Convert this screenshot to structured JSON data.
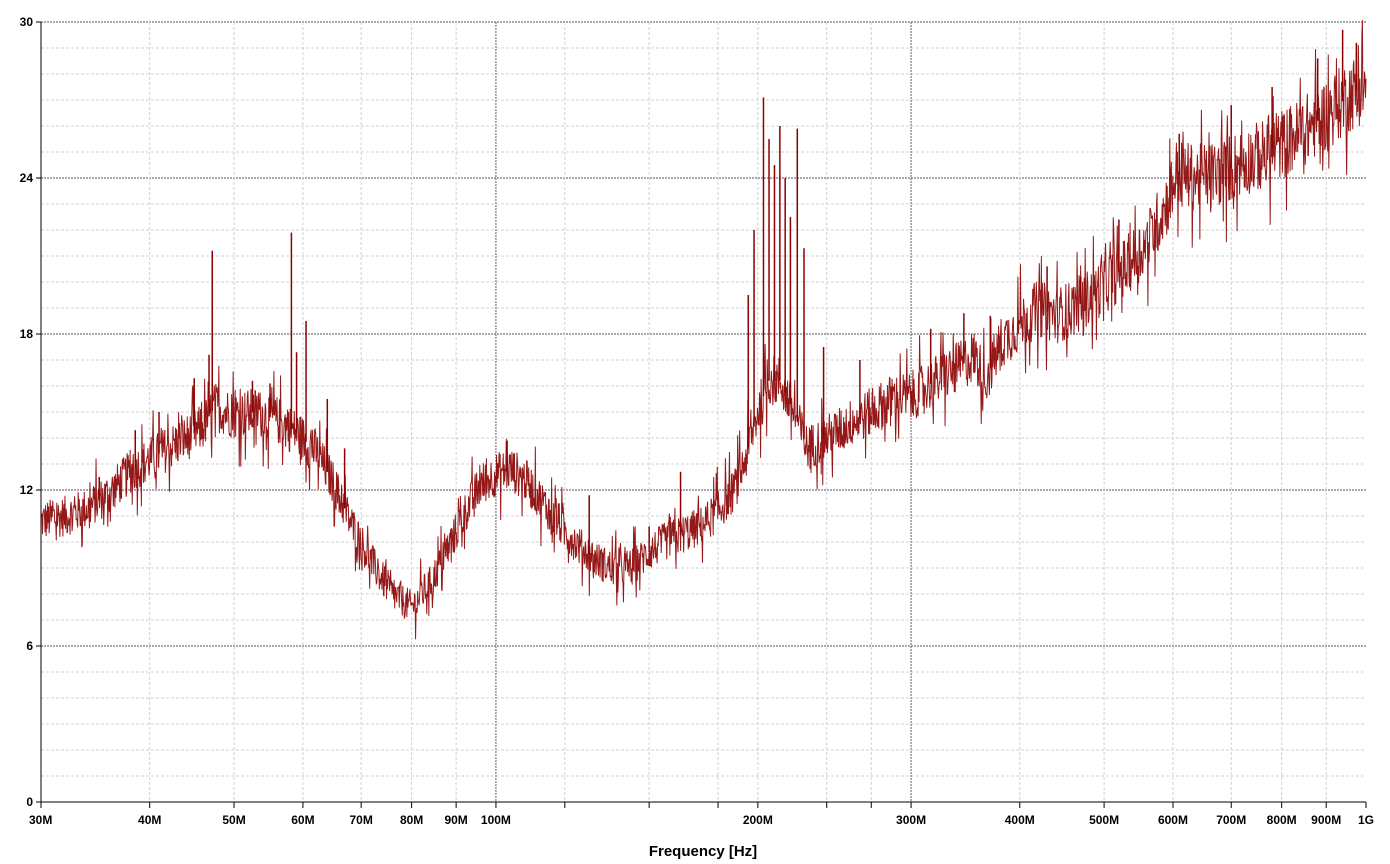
{
  "chart_data": {
    "type": "line",
    "xlabel": "Frequency [Hz]",
    "ylabel": "",
    "x_scale": "log",
    "xlim": [
      30000000,
      1000000000
    ],
    "ylim": [
      0,
      30
    ],
    "y_ticks": [
      {
        "value": 0,
        "label": "0"
      },
      {
        "value": 6,
        "label": "6"
      },
      {
        "value": 12,
        "label": "12"
      },
      {
        "value": 18,
        "label": "18"
      },
      {
        "value": 24,
        "label": "24"
      },
      {
        "value": 30,
        "label": "30"
      }
    ],
    "x_ticks": [
      {
        "value": 30000000,
        "label": "30M"
      },
      {
        "value": 40000000,
        "label": "40M"
      },
      {
        "value": 50000000,
        "label": "50M"
      },
      {
        "value": 60000000,
        "label": "60M"
      },
      {
        "value": 70000000,
        "label": "70M"
      },
      {
        "value": 80000000,
        "label": "80M"
      },
      {
        "value": 90000000,
        "label": "90M"
      },
      {
        "value": 100000000,
        "label": "100M"
      },
      {
        "value": 200000000,
        "label": "200M"
      },
      {
        "value": 300000000,
        "label": "300M"
      },
      {
        "value": 400000000,
        "label": "400M"
      },
      {
        "value": 500000000,
        "label": "500M"
      },
      {
        "value": 600000000,
        "label": "600M"
      },
      {
        "value": 700000000,
        "label": "700M"
      },
      {
        "value": 800000000,
        "label": "800M"
      },
      {
        "value": 900000000,
        "label": "900M"
      },
      {
        "value": 1000000000,
        "label": "1G"
      }
    ],
    "x_minor_gridlines": [
      120000000,
      150000000,
      180000000,
      240000000,
      270000000
    ],
    "grid": true,
    "series": [
      {
        "color": "#8b0000",
        "points": [
          [
            30000000,
            10.8
          ],
          [
            32000000,
            11.0
          ],
          [
            34000000,
            11.3
          ],
          [
            36000000,
            11.9
          ],
          [
            38000000,
            12.7
          ],
          [
            40000000,
            13.2
          ],
          [
            42000000,
            13.6
          ],
          [
            44000000,
            14.0
          ],
          [
            46000000,
            14.4
          ],
          [
            47500000,
            15.2
          ],
          [
            50000000,
            14.9
          ],
          [
            53000000,
            15.0
          ],
          [
            56000000,
            14.7
          ],
          [
            59000000,
            14.2
          ],
          [
            62000000,
            13.5
          ],
          [
            65000000,
            12.3
          ],
          [
            68000000,
            10.8
          ],
          [
            72000000,
            9.2
          ],
          [
            76000000,
            8.0
          ],
          [
            80000000,
            7.5
          ],
          [
            84000000,
            8.4
          ],
          [
            88000000,
            9.7
          ],
          [
            92000000,
            11.1
          ],
          [
            96000000,
            12.2
          ],
          [
            100000000,
            12.6
          ],
          [
            104000000,
            12.8
          ],
          [
            108000000,
            12.4
          ],
          [
            114000000,
            11.4
          ],
          [
            120000000,
            10.4
          ],
          [
            126000000,
            9.7
          ],
          [
            132000000,
            9.2
          ],
          [
            138000000,
            8.9
          ],
          [
            144000000,
            9.1
          ],
          [
            150000000,
            9.6
          ],
          [
            156000000,
            10.0
          ],
          [
            164000000,
            10.3
          ],
          [
            172000000,
            10.6
          ],
          [
            180000000,
            11.2
          ],
          [
            188000000,
            12.0
          ],
          [
            194000000,
            13.3
          ],
          [
            200000000,
            15.0
          ],
          [
            206000000,
            16.2
          ],
          [
            212000000,
            16.2
          ],
          [
            220000000,
            15.0
          ],
          [
            228000000,
            13.6
          ],
          [
            236000000,
            13.9
          ],
          [
            246000000,
            14.2
          ],
          [
            256000000,
            14.6
          ],
          [
            270000000,
            15.0
          ],
          [
            285000000,
            15.5
          ],
          [
            300000000,
            15.6
          ],
          [
            320000000,
            16.2
          ],
          [
            340000000,
            16.7
          ],
          [
            355000000,
            17.2
          ],
          [
            365000000,
            16.2
          ],
          [
            380000000,
            17.6
          ],
          [
            400000000,
            18.4
          ],
          [
            420000000,
            19.0
          ],
          [
            440000000,
            18.7
          ],
          [
            460000000,
            19.0
          ],
          [
            480000000,
            19.4
          ],
          [
            500000000,
            19.9
          ],
          [
            530000000,
            20.6
          ],
          [
            560000000,
            21.5
          ],
          [
            590000000,
            23.0
          ],
          [
            605000000,
            24.2
          ],
          [
            640000000,
            24.0
          ],
          [
            680000000,
            24.2
          ],
          [
            720000000,
            24.6
          ],
          [
            760000000,
            24.9
          ],
          [
            800000000,
            25.3
          ],
          [
            840000000,
            25.7
          ],
          [
            880000000,
            26.2
          ],
          [
            920000000,
            26.7
          ],
          [
            960000000,
            27.2
          ],
          [
            1000000000,
            27.6
          ]
        ],
        "spikes": [
          [
            35000000,
            12.5
          ],
          [
            38500000,
            14.3
          ],
          [
            41000000,
            15.0
          ],
          [
            45000000,
            16.3
          ],
          [
            46800000,
            17.2
          ],
          [
            47200000,
            21.2
          ],
          [
            52500000,
            16.2
          ],
          [
            55000000,
            16.1
          ],
          [
            58200000,
            21.9
          ],
          [
            59000000,
            17.3
          ],
          [
            60500000,
            18.5
          ],
          [
            64000000,
            15.5
          ],
          [
            67000000,
            13.6
          ],
          [
            103000000,
            13.9
          ],
          [
            128000000,
            11.8
          ],
          [
            150000000,
            10.6
          ],
          [
            163000000,
            12.7
          ],
          [
            195000000,
            19.5
          ],
          [
            198000000,
            22.0
          ],
          [
            203000000,
            27.1
          ],
          [
            206000000,
            25.5
          ],
          [
            209000000,
            24.5
          ],
          [
            212000000,
            26.0
          ],
          [
            215000000,
            24.0
          ],
          [
            218000000,
            22.5
          ],
          [
            222000000,
            25.9
          ],
          [
            226000000,
            21.3
          ],
          [
            238000000,
            17.5
          ],
          [
            262000000,
            17.0
          ],
          [
            316000000,
            18.2
          ],
          [
            345000000,
            18.8
          ],
          [
            370000000,
            18.7
          ],
          [
            430000000,
            20.6
          ],
          [
            470000000,
            20.2
          ],
          [
            520000000,
            22.4
          ],
          [
            610000000,
            25.7
          ],
          [
            700000000,
            26.8
          ],
          [
            780000000,
            27.5
          ],
          [
            880000000,
            28.6
          ],
          [
            940000000,
            29.7
          ],
          [
            975000000,
            29.2
          ]
        ]
      }
    ]
  }
}
